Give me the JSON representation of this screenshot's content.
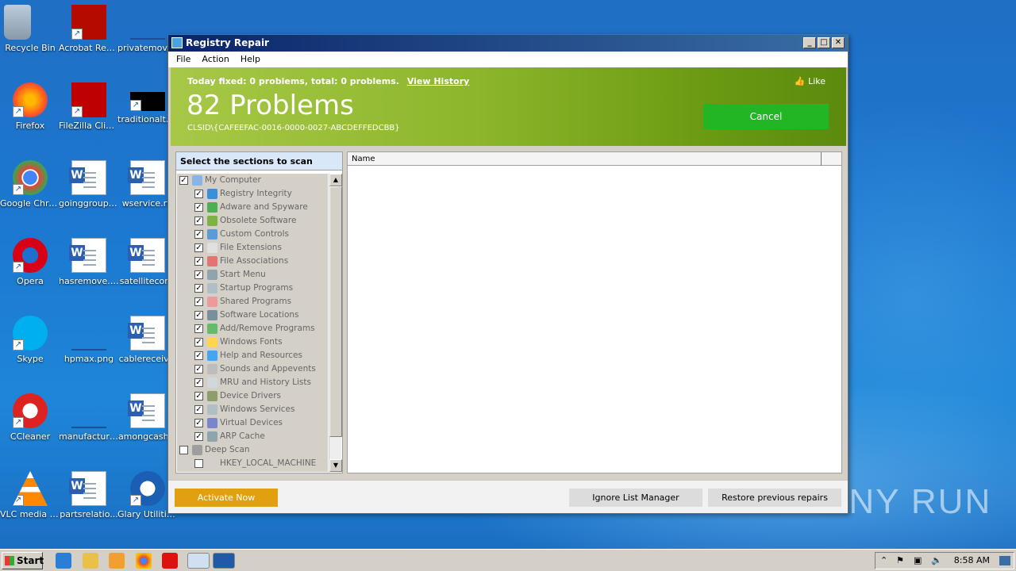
{
  "desktop": {
    "icons": [
      {
        "label": "Recycle Bin",
        "icon": "recycle-bin-icon"
      },
      {
        "label": "Acrobat Reader DC",
        "icon": "acrobat-icon"
      },
      {
        "label": "privatemovi...",
        "icon": "blank-icon"
      },
      {
        "label": "Firefox",
        "icon": "firefox-icon"
      },
      {
        "label": "FileZilla Client",
        "icon": "filezilla-icon"
      },
      {
        "label": "traditionalth...",
        "icon": "black-image-icon"
      },
      {
        "label": "Google Chrome",
        "icon": "chrome-icon"
      },
      {
        "label": "goinggroup.rtf",
        "icon": "word-doc-icon"
      },
      {
        "label": "wservice.rtf",
        "icon": "word-doc-icon"
      },
      {
        "label": "Opera",
        "icon": "opera-icon"
      },
      {
        "label": "hasremove.rtf",
        "icon": "word-doc-icon"
      },
      {
        "label": "satellitecor...",
        "icon": "word-doc-icon"
      },
      {
        "label": "Skype",
        "icon": "skype-icon"
      },
      {
        "label": "hpmax.png",
        "icon": "blank-icon"
      },
      {
        "label": "cablereceiv...",
        "icon": "word-doc-icon"
      },
      {
        "label": "CCleaner",
        "icon": "ccleaner-icon"
      },
      {
        "label": "manufacturi...",
        "icon": "blank-icon"
      },
      {
        "label": "amongcash...",
        "icon": "word-doc-icon"
      },
      {
        "label": "VLC media player",
        "icon": "vlc-icon"
      },
      {
        "label": "partsrelatio...",
        "icon": "word-doc-icon"
      },
      {
        "label": "Glary Utilities 5",
        "icon": "glary-icon"
      }
    ]
  },
  "window": {
    "title": "Registry Repair",
    "menu": [
      "File",
      "Action",
      "Help"
    ],
    "banner": {
      "today": "Today fixed: 0 problems, total: 0 problems.",
      "view_history": "View History",
      "like": "Like",
      "count": "82 Problems",
      "clsid": "CLSID\\{CAFEEFAC-0016-0000-0027-ABCDEFFEDCBB}",
      "cancel": "Cancel"
    },
    "left_header": "Select the sections to scan",
    "tree": [
      {
        "label": "My Computer",
        "level": 0,
        "checked": true,
        "color": "#8ab4e8"
      },
      {
        "label": "Registry Integrity",
        "level": 1,
        "checked": true,
        "color": "#3b8fd9"
      },
      {
        "label": "Adware and Spyware",
        "level": 1,
        "checked": true,
        "color": "#4caf50"
      },
      {
        "label": "Obsolete Software",
        "level": 1,
        "checked": true,
        "color": "#7cb342"
      },
      {
        "label": "Custom Controls",
        "level": 1,
        "checked": true,
        "color": "#5c9bd5"
      },
      {
        "label": "File Extensions",
        "level": 1,
        "checked": true,
        "color": "#e0e0e0"
      },
      {
        "label": "File Associations",
        "level": 1,
        "checked": true,
        "color": "#e57373"
      },
      {
        "label": "Start Menu",
        "level": 1,
        "checked": true,
        "color": "#90a4ae"
      },
      {
        "label": "Startup Programs",
        "level": 1,
        "checked": true,
        "color": "#b0bec5"
      },
      {
        "label": "Shared Programs",
        "level": 1,
        "checked": true,
        "color": "#ef9a9a"
      },
      {
        "label": "Software Locations",
        "level": 1,
        "checked": true,
        "color": "#78909c"
      },
      {
        "label": "Add/Remove Programs",
        "level": 1,
        "checked": true,
        "color": "#66bb6a"
      },
      {
        "label": "Windows Fonts",
        "level": 1,
        "checked": true,
        "color": "#ffd54f"
      },
      {
        "label": "Help and Resources",
        "level": 1,
        "checked": true,
        "color": "#42a5f5"
      },
      {
        "label": "Sounds and Appevents",
        "level": 1,
        "checked": true,
        "color": "#bdbdbd"
      },
      {
        "label": "MRU and History Lists",
        "level": 1,
        "checked": true,
        "color": "#cfd8dc"
      },
      {
        "label": "Device Drivers",
        "level": 1,
        "checked": true,
        "color": "#8d9e6a"
      },
      {
        "label": "Windows Services",
        "level": 1,
        "checked": true,
        "color": "#b0bec5"
      },
      {
        "label": "Virtual Devices",
        "level": 1,
        "checked": true,
        "color": "#7986cb"
      },
      {
        "label": "ARP Cache",
        "level": 1,
        "checked": true,
        "color": "#90a4ae"
      },
      {
        "label": "Deep Scan",
        "level": 0,
        "checked": false,
        "color": "#9e9e9e"
      },
      {
        "label": "HKEY_LOCAL_MACHINE",
        "level": 1,
        "checked": false,
        "color": "#d4d0c8"
      }
    ],
    "list_column": "Name",
    "buttons": {
      "activate": "Activate Now",
      "ignore": "Ignore List Manager",
      "restore": "Restore previous repairs"
    }
  },
  "taskbar": {
    "start": "Start",
    "clock": "8:58 AM"
  },
  "watermark": "ANY RUN"
}
